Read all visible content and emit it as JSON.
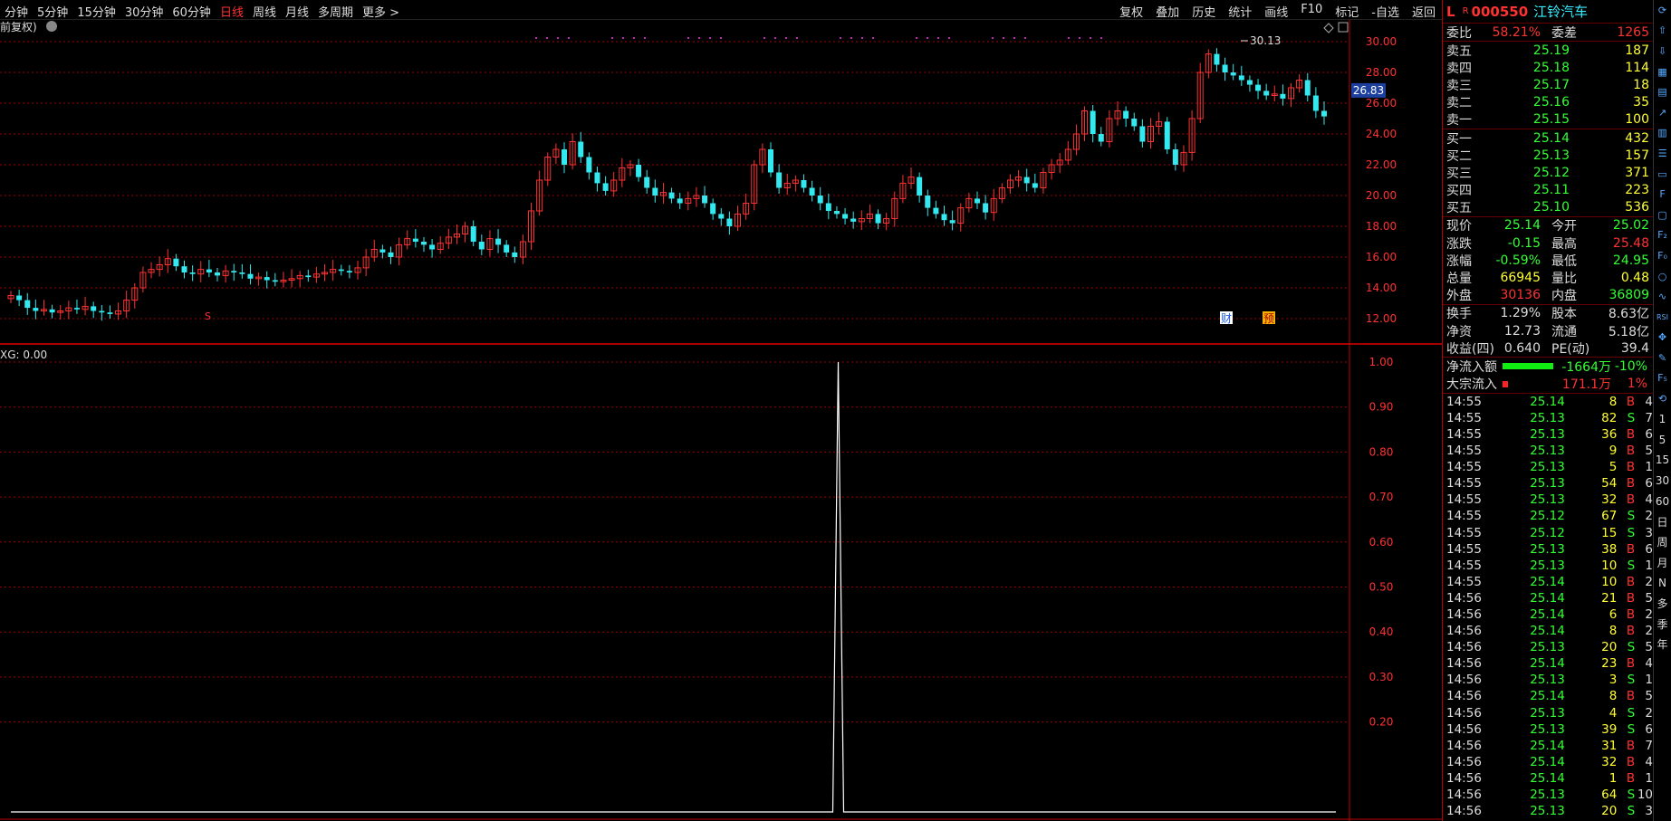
{
  "toolbar": {
    "periods": [
      "分钟",
      "5分钟",
      "15分钟",
      "30分钟",
      "60分钟",
      "日线",
      "周线",
      "月线",
      "多周期",
      "更多 >"
    ],
    "active_period": "日线",
    "tools": [
      "复权",
      "叠加",
      "历史",
      "统计",
      "画线",
      "F10",
      "标记",
      "-自选",
      "返回"
    ]
  },
  "main_chart": {
    "adjust_label": "前复权)",
    "high_label": "30.13",
    "price_tag": "26.83",
    "s_marker": "S",
    "badge_cai": "财",
    "badge_yu": "预",
    "y_ticks": [
      "30.00",
      "28.00",
      "26.00",
      "24.00",
      "22.00",
      "20.00",
      "18.00",
      "16.00",
      "14.00",
      "12.00"
    ]
  },
  "sub_chart": {
    "indicator_label": "XG: 0.00",
    "y_ticks": [
      "1.00",
      "0.90",
      "0.80",
      "0.70",
      "0.60",
      "0.50",
      "0.40",
      "0.30",
      "0.20"
    ]
  },
  "chart_data": {
    "type": "candlestick",
    "series": [
      {
        "name": "",
        "close_path": [
          13.5,
          13.2,
          12.7,
          12.5,
          12.6,
          12.4,
          12.5,
          12.7,
          12.6,
          12.8,
          12.5,
          12.4,
          12.3,
          12.5,
          13.2,
          14.0,
          15.0,
          15.2,
          15.5,
          15.9,
          15.4,
          15.0,
          14.9,
          15.2,
          15.0,
          14.8,
          15.1,
          15.0,
          14.9,
          14.6,
          14.7,
          14.5,
          14.4,
          14.5,
          14.6,
          14.8,
          14.7,
          14.9,
          15.0,
          15.2,
          15.1,
          15.0,
          15.3,
          16.0,
          16.5,
          16.3,
          16.0,
          16.8,
          17.2,
          17.0,
          16.8,
          16.5,
          16.9,
          17.3,
          17.5,
          18.0,
          17.0,
          16.5,
          17.2,
          16.8,
          16.3,
          16.0,
          17.0,
          19.0,
          21.0,
          22.5,
          23.0,
          22.0,
          23.5,
          22.5,
          21.5,
          20.8,
          20.3,
          21.0,
          21.8,
          22.0,
          21.2,
          20.5,
          20.0,
          20.2,
          19.8,
          19.5,
          19.8,
          20.0,
          19.5,
          18.8,
          18.5,
          18.0,
          18.8,
          19.5,
          22.0,
          23.0,
          21.5,
          20.5,
          20.8,
          21.0,
          20.5,
          20.0,
          19.5,
          19.0,
          18.8,
          18.5,
          18.3,
          18.5,
          18.8,
          18.2,
          18.5,
          19.8,
          20.8,
          21.2,
          20.0,
          19.2,
          18.8,
          18.4,
          18.2,
          19.2,
          19.8,
          19.5,
          18.9,
          19.8,
          20.5,
          21.0,
          21.2,
          20.8,
          20.5,
          21.5,
          22.0,
          22.3,
          23.0,
          24.0,
          25.5,
          24.0,
          23.5,
          25.0,
          25.5,
          25.0,
          24.5,
          23.5,
          24.5,
          24.8,
          23.0,
          22.0,
          22.8,
          25.0,
          28.0,
          29.2,
          28.5,
          28.0,
          27.8,
          27.5,
          27.2,
          26.8,
          26.5,
          26.6,
          26.3,
          27.0,
          27.5,
          26.5,
          25.5,
          25.14
        ]
      },
      {
        "name": "XG",
        "spike_index": 0.63,
        "values_note": "single spike to 1.00"
      }
    ],
    "ylim_main": [
      12,
      30
    ],
    "ylim_sub": [
      0,
      1
    ],
    "grid": true
  },
  "panel": {
    "title_l": "L",
    "title_r": "R",
    "code": "000550",
    "name": "江铃汽车",
    "weibi_label": "委比",
    "weibi_value": "58.21%",
    "weicha_label": "委差",
    "weicha_value": "1265",
    "asks": [
      {
        "label": "卖五",
        "price": "25.19",
        "vol": "187"
      },
      {
        "label": "卖四",
        "price": "25.18",
        "vol": "114"
      },
      {
        "label": "卖三",
        "price": "25.17",
        "vol": "18"
      },
      {
        "label": "卖二",
        "price": "25.16",
        "vol": "35"
      },
      {
        "label": "卖一",
        "price": "25.15",
        "vol": "100"
      }
    ],
    "bids": [
      {
        "label": "买一",
        "price": "25.14",
        "vol": "432"
      },
      {
        "label": "买二",
        "price": "25.13",
        "vol": "157"
      },
      {
        "label": "买三",
        "price": "25.12",
        "vol": "371"
      },
      {
        "label": "买四",
        "price": "25.11",
        "vol": "223"
      },
      {
        "label": "买五",
        "price": "25.10",
        "vol": "536"
      }
    ],
    "quote": [
      {
        "a": "现价",
        "b": "25.14",
        "bc": "green",
        "c": "今开",
        "d": "25.02",
        "dc": "green"
      },
      {
        "a": "涨跌",
        "b": "-0.15",
        "bc": "green",
        "c": "最高",
        "d": "25.48",
        "dc": "red"
      },
      {
        "a": "涨幅",
        "b": "-0.59%",
        "bc": "green",
        "c": "最低",
        "d": "24.95",
        "dc": "green"
      },
      {
        "a": "总量",
        "b": "66945",
        "bc": "yellow",
        "c": "量比",
        "d": "0.48",
        "dc": "yellow"
      },
      {
        "a": "外盘",
        "b": "30136",
        "bc": "red",
        "c": "内盘",
        "d": "36809",
        "dc": "green"
      }
    ],
    "fund": [
      {
        "a": "换手",
        "b": "1.29%",
        "c": "股本",
        "d": "8.63亿"
      },
      {
        "a": "净资",
        "b": "12.73",
        "c": "流通",
        "d": "5.18亿"
      },
      {
        "a": "收益(四)",
        "b": "0.640",
        "c": "PE(动)",
        "d": "39.4"
      }
    ],
    "flow": [
      {
        "label": "净流入额",
        "value": "-1664万",
        "pct": "-10%"
      },
      {
        "label": "大宗流入",
        "value": "171.1万",
        "pct": "1%"
      }
    ],
    "ticks": [
      {
        "t": "14:55",
        "p": "25.14",
        "v": "8",
        "s": "B",
        "n": "4"
      },
      {
        "t": "14:55",
        "p": "25.13",
        "v": "82",
        "s": "S",
        "n": "7"
      },
      {
        "t": "14:55",
        "p": "25.13",
        "v": "36",
        "s": "B",
        "n": "6"
      },
      {
        "t": "14:55",
        "p": "25.13",
        "v": "9",
        "s": "B",
        "n": "5"
      },
      {
        "t": "14:55",
        "p": "25.13",
        "v": "5",
        "s": "B",
        "n": "1"
      },
      {
        "t": "14:55",
        "p": "25.13",
        "v": "54",
        "s": "B",
        "n": "6"
      },
      {
        "t": "14:55",
        "p": "25.13",
        "v": "32",
        "s": "B",
        "n": "4"
      },
      {
        "t": "14:55",
        "p": "25.12",
        "v": "67",
        "s": "S",
        "n": "2"
      },
      {
        "t": "14:55",
        "p": "25.12",
        "v": "15",
        "s": "S",
        "n": "3"
      },
      {
        "t": "14:55",
        "p": "25.13",
        "v": "38",
        "s": "B",
        "n": "6"
      },
      {
        "t": "14:55",
        "p": "25.13",
        "v": "10",
        "s": "S",
        "n": "1"
      },
      {
        "t": "14:55",
        "p": "25.14",
        "v": "10",
        "s": "B",
        "n": "2"
      },
      {
        "t": "14:56",
        "p": "25.14",
        "v": "21",
        "s": "B",
        "n": "5"
      },
      {
        "t": "14:56",
        "p": "25.14",
        "v": "6",
        "s": "B",
        "n": "2"
      },
      {
        "t": "14:56",
        "p": "25.14",
        "v": "8",
        "s": "B",
        "n": "2"
      },
      {
        "t": "14:56",
        "p": "25.13",
        "v": "20",
        "s": "S",
        "n": "5"
      },
      {
        "t": "14:56",
        "p": "25.14",
        "v": "23",
        "s": "B",
        "n": "4"
      },
      {
        "t": "14:56",
        "p": "25.13",
        "v": "3",
        "s": "S",
        "n": "1"
      },
      {
        "t": "14:56",
        "p": "25.14",
        "v": "8",
        "s": "B",
        "n": "5"
      },
      {
        "t": "14:56",
        "p": "25.13",
        "v": "4",
        "s": "S",
        "n": "2"
      },
      {
        "t": "14:56",
        "p": "25.13",
        "v": "39",
        "s": "S",
        "n": "6"
      },
      {
        "t": "14:56",
        "p": "25.14",
        "v": "31",
        "s": "B",
        "n": "7"
      },
      {
        "t": "14:56",
        "p": "25.14",
        "v": "32",
        "s": "B",
        "n": "4"
      },
      {
        "t": "14:56",
        "p": "25.14",
        "v": "1",
        "s": "B",
        "n": "1"
      },
      {
        "t": "14:56",
        "p": "25.13",
        "v": "64",
        "s": "S",
        "n": "10"
      },
      {
        "t": "14:56",
        "p": "25.13",
        "v": "20",
        "s": "S",
        "n": "3"
      }
    ]
  },
  "iconbar": {
    "icons": [
      "refresh-icon",
      "up-arrow-icon",
      "down-arrow-icon",
      "grid-icon",
      "table-icon",
      "line-chart-icon",
      "bar-chart-icon",
      "list-icon",
      "page-icon",
      "f-icon",
      "doc-icon",
      "f2-icon",
      "fo-icon",
      "circle-icon",
      "wave-icon",
      "rsi-icon",
      "move-icon",
      "pen-icon",
      "f5-icon",
      "refresh2-icon"
    ],
    "periods": [
      "1",
      "5",
      "15",
      "30",
      "60",
      "日",
      "周",
      "月",
      "N",
      "多",
      "季",
      "年"
    ]
  },
  "colors": {
    "up": "#ff3232",
    "down": "#33e8ee",
    "grid": "#a00000",
    "bg": "#000000"
  }
}
